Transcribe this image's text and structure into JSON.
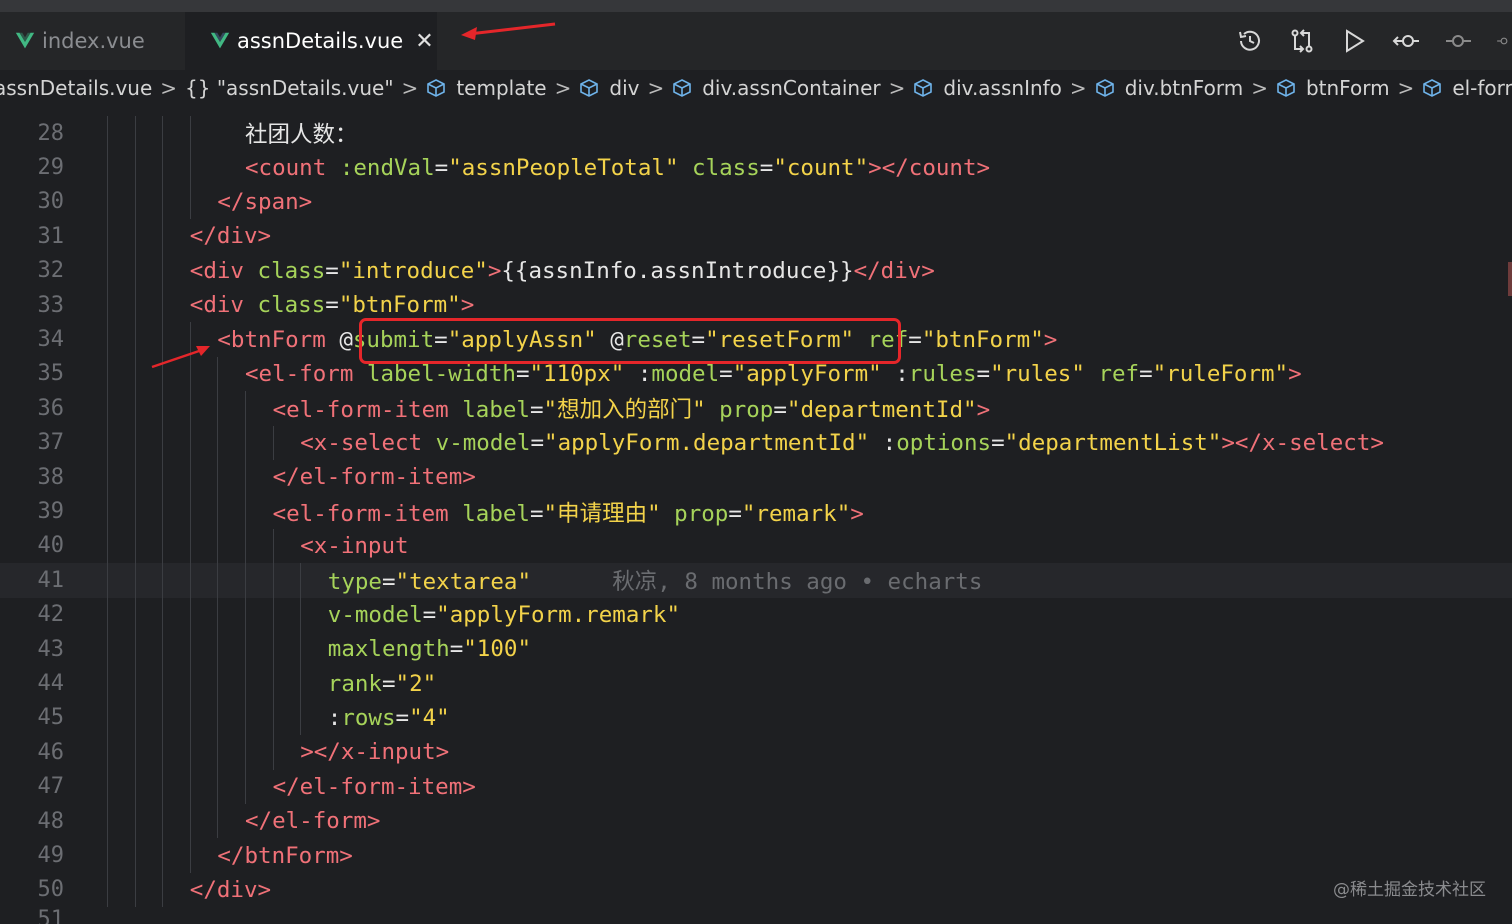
{
  "tabs": [
    {
      "label": "index.vue",
      "active": false
    },
    {
      "label": "assnDetails.vue",
      "active": true
    }
  ],
  "toolbar": {
    "icons": [
      "history-icon",
      "git-compare-icon",
      "run-icon",
      "go-back-icon",
      "go-forward-icon",
      "more-icon"
    ]
  },
  "breadcrumb": {
    "file": "assnDetails.vue",
    "items": [
      "{} \"assnDetails.vue\"",
      "template",
      "div",
      "div.assnContainer",
      "div.assnInfo",
      "div.btnForm",
      "btnForm",
      "el-form"
    ]
  },
  "editor": {
    "partial_top_line": "27",
    "partial_bottom_line": "51",
    "lines": [
      {
        "n": "28",
        "indent": 9,
        "tokens": [
          [
            "p",
            "社团人数："
          ]
        ]
      },
      {
        "n": "29",
        "indent": 9,
        "tokens": [
          [
            "t",
            "<count "
          ],
          [
            "a",
            ":endVal"
          ],
          [
            "p",
            "="
          ],
          [
            "s",
            "\"assnPeopleTotal\""
          ],
          [
            "p",
            " "
          ],
          [
            "a",
            "class"
          ],
          [
            "p",
            "="
          ],
          [
            "s",
            "\"count\""
          ],
          [
            "t",
            "></count>"
          ]
        ]
      },
      {
        "n": "30",
        "indent": 8,
        "tokens": [
          [
            "t",
            "</span>"
          ]
        ]
      },
      {
        "n": "31",
        "indent": 7,
        "tokens": [
          [
            "t",
            "</div>"
          ]
        ]
      },
      {
        "n": "32",
        "indent": 7,
        "tokens": [
          [
            "t",
            "<div "
          ],
          [
            "a",
            "class"
          ],
          [
            "p",
            "="
          ],
          [
            "s",
            "\"introduce\""
          ],
          [
            "t",
            ">"
          ],
          [
            "p",
            "{{assnInfo.assnIntroduce}}"
          ],
          [
            "t",
            "</div>"
          ]
        ]
      },
      {
        "n": "33",
        "indent": 7,
        "tokens": [
          [
            "t",
            "<div "
          ],
          [
            "a",
            "class"
          ],
          [
            "p",
            "="
          ],
          [
            "s",
            "\"btnForm\""
          ],
          [
            "t",
            ">"
          ]
        ]
      },
      {
        "n": "34",
        "indent": 8,
        "tokens": [
          [
            "t",
            "<btnForm "
          ],
          [
            "p",
            "@"
          ],
          [
            "a",
            "submit"
          ],
          [
            "p",
            "="
          ],
          [
            "s",
            "\"applyAssn\""
          ],
          [
            "p",
            " @"
          ],
          [
            "a",
            "reset"
          ],
          [
            "p",
            "="
          ],
          [
            "s",
            "\"resetForm\""
          ],
          [
            "p",
            " "
          ],
          [
            "a",
            "ref"
          ],
          [
            "p",
            "="
          ],
          [
            "s",
            "\"btnForm\""
          ],
          [
            "t",
            ">"
          ]
        ]
      },
      {
        "n": "35",
        "indent": 9,
        "tokens": [
          [
            "t",
            "<el-form "
          ],
          [
            "a",
            "label-width"
          ],
          [
            "p",
            "="
          ],
          [
            "s",
            "\"110px\""
          ],
          [
            "p",
            " :"
          ],
          [
            "a",
            "model"
          ],
          [
            "p",
            "="
          ],
          [
            "s",
            "\"applyForm\""
          ],
          [
            "p",
            " :"
          ],
          [
            "a",
            "rules"
          ],
          [
            "p",
            "="
          ],
          [
            "s",
            "\"rules\""
          ],
          [
            "p",
            " "
          ],
          [
            "a",
            "ref"
          ],
          [
            "p",
            "="
          ],
          [
            "s",
            "\"ruleForm\""
          ],
          [
            "t",
            ">"
          ]
        ]
      },
      {
        "n": "36",
        "indent": 10,
        "tokens": [
          [
            "t",
            "<el-form-item "
          ],
          [
            "a",
            "label"
          ],
          [
            "p",
            "="
          ],
          [
            "s",
            "\"想加入的部门\""
          ],
          [
            "p",
            " "
          ],
          [
            "a",
            "prop"
          ],
          [
            "p",
            "="
          ],
          [
            "s",
            "\"departmentId\""
          ],
          [
            "t",
            ">"
          ]
        ]
      },
      {
        "n": "37",
        "indent": 11,
        "tokens": [
          [
            "t",
            "<x-select "
          ],
          [
            "a",
            "v-model"
          ],
          [
            "p",
            "="
          ],
          [
            "s",
            "\"applyForm.departmentId\""
          ],
          [
            "p",
            " :"
          ],
          [
            "a",
            "options"
          ],
          [
            "p",
            "="
          ],
          [
            "s",
            "\"departmentList\""
          ],
          [
            "t",
            "></x-select>"
          ]
        ]
      },
      {
        "n": "38",
        "indent": 10,
        "tokens": [
          [
            "t",
            "</el-form-item>"
          ]
        ]
      },
      {
        "n": "39",
        "indent": 10,
        "tokens": [
          [
            "t",
            "<el-form-item "
          ],
          [
            "a",
            "label"
          ],
          [
            "p",
            "="
          ],
          [
            "s",
            "\"申请理由\""
          ],
          [
            "p",
            " "
          ],
          [
            "a",
            "prop"
          ],
          [
            "p",
            "="
          ],
          [
            "s",
            "\"remark\""
          ],
          [
            "t",
            ">"
          ]
        ]
      },
      {
        "n": "40",
        "indent": 11,
        "tokens": [
          [
            "t",
            "<x-input"
          ]
        ]
      },
      {
        "n": "41",
        "indent": 12,
        "tokens": [
          [
            "a",
            "type"
          ],
          [
            "p",
            "="
          ],
          [
            "s",
            "\"textarea\""
          ]
        ],
        "blame": "秋凉, 8 months ago • echarts",
        "current": true
      },
      {
        "n": "42",
        "indent": 12,
        "tokens": [
          [
            "a",
            "v-model"
          ],
          [
            "p",
            "="
          ],
          [
            "s",
            "\"applyForm.remark\""
          ]
        ]
      },
      {
        "n": "43",
        "indent": 12,
        "tokens": [
          [
            "a",
            "maxlength"
          ],
          [
            "p",
            "="
          ],
          [
            "s",
            "\"100\""
          ]
        ]
      },
      {
        "n": "44",
        "indent": 12,
        "tokens": [
          [
            "a",
            "rank"
          ],
          [
            "p",
            "="
          ],
          [
            "s",
            "\"2\""
          ]
        ]
      },
      {
        "n": "45",
        "indent": 12,
        "tokens": [
          [
            "p",
            ":"
          ],
          [
            "a",
            "rows"
          ],
          [
            "p",
            "="
          ],
          [
            "s",
            "\"4\""
          ]
        ]
      },
      {
        "n": "46",
        "indent": 11,
        "tokens": [
          [
            "t",
            "></x-input>"
          ]
        ]
      },
      {
        "n": "47",
        "indent": 10,
        "tokens": [
          [
            "t",
            "</el-form-item>"
          ]
        ]
      },
      {
        "n": "48",
        "indent": 9,
        "tokens": [
          [
            "t",
            "</el-form>"
          ]
        ]
      },
      {
        "n": "49",
        "indent": 8,
        "tokens": [
          [
            "t",
            "</btnForm>"
          ]
        ]
      },
      {
        "n": "50",
        "indent": 7,
        "tokens": [
          [
            "t",
            "</div>"
          ]
        ]
      }
    ]
  },
  "watermark": "@稀土掘金技术社区",
  "colors": {
    "tag": "#f07178",
    "attr": "#a6d35a",
    "string": "#f3d34a",
    "highlight": "#e5262a"
  }
}
